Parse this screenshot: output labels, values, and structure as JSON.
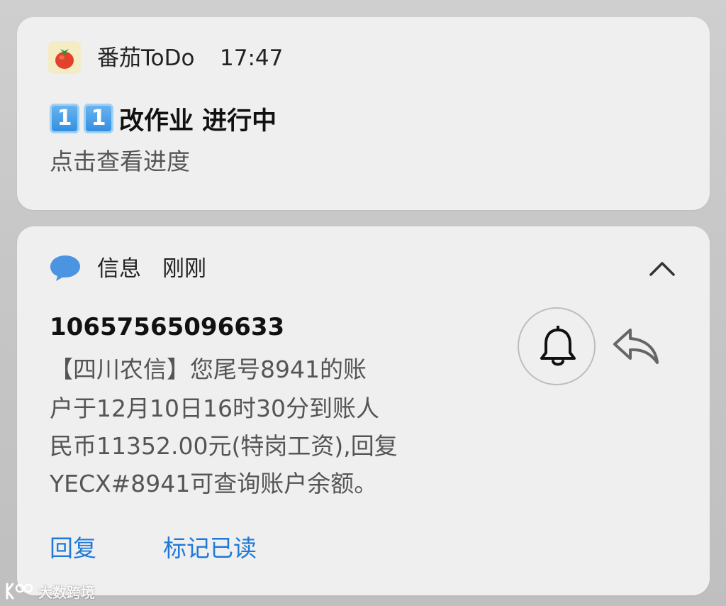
{
  "notifications": {
    "todo": {
      "app_name": "番茄ToDo",
      "time": "17:47",
      "title_emoji_digits": [
        "1",
        "1"
      ],
      "title_text": "改作业 进行中",
      "subtitle": "点击查看进度",
      "icon": "tomato-icon"
    },
    "message": {
      "app_name": "信息",
      "time": "刚刚",
      "sender": "10657565096633",
      "body_lines": [
        "【四川农信】您尾号8941的账",
        "户于12月10日16时30分到账人",
        "民币11352.00元(特岗工资),回复",
        "YECX#8941可查询账户余额。"
      ],
      "actions": {
        "reply": "回复",
        "mark_read": "标记已读"
      },
      "icons": {
        "app": "chat-bubble-icon",
        "collapse": "chevron-up-icon",
        "bell": "bell-icon",
        "reply": "reply-arrow-icon"
      },
      "accent_color": "#1f79d9"
    }
  },
  "watermark": {
    "text": "大数跨境"
  }
}
